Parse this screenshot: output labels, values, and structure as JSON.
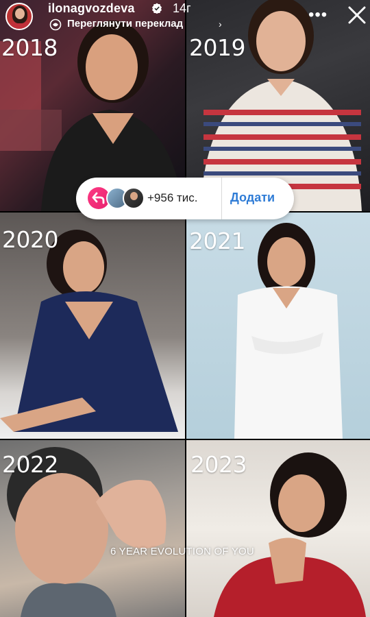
{
  "header": {
    "username": "ilonagvozdeva",
    "time": "14г",
    "translate_label": "Переглянути переклад",
    "icons": {
      "avatar": "avatar",
      "verified": "verified-badge-icon",
      "translate": "translate-icon",
      "chevron": "chevron-right-icon",
      "more": "more-icon",
      "close": "close-icon"
    }
  },
  "grid": [
    {
      "year": "2018"
    },
    {
      "year": "2019"
    },
    {
      "year": "2020"
    },
    {
      "year": "2021"
    },
    {
      "year": "2022"
    },
    {
      "year": "2023"
    }
  ],
  "reaction_pill": {
    "count_label": "+956 тис.",
    "add_label": "Додати",
    "icons": {
      "reshare": "reshare-arrow-icon"
    }
  },
  "caption": "6 YEAR EVOLUTION OF YOU",
  "colors": {
    "reshare_pink": "#fd3a84",
    "add_blue": "#2f7cd6"
  }
}
